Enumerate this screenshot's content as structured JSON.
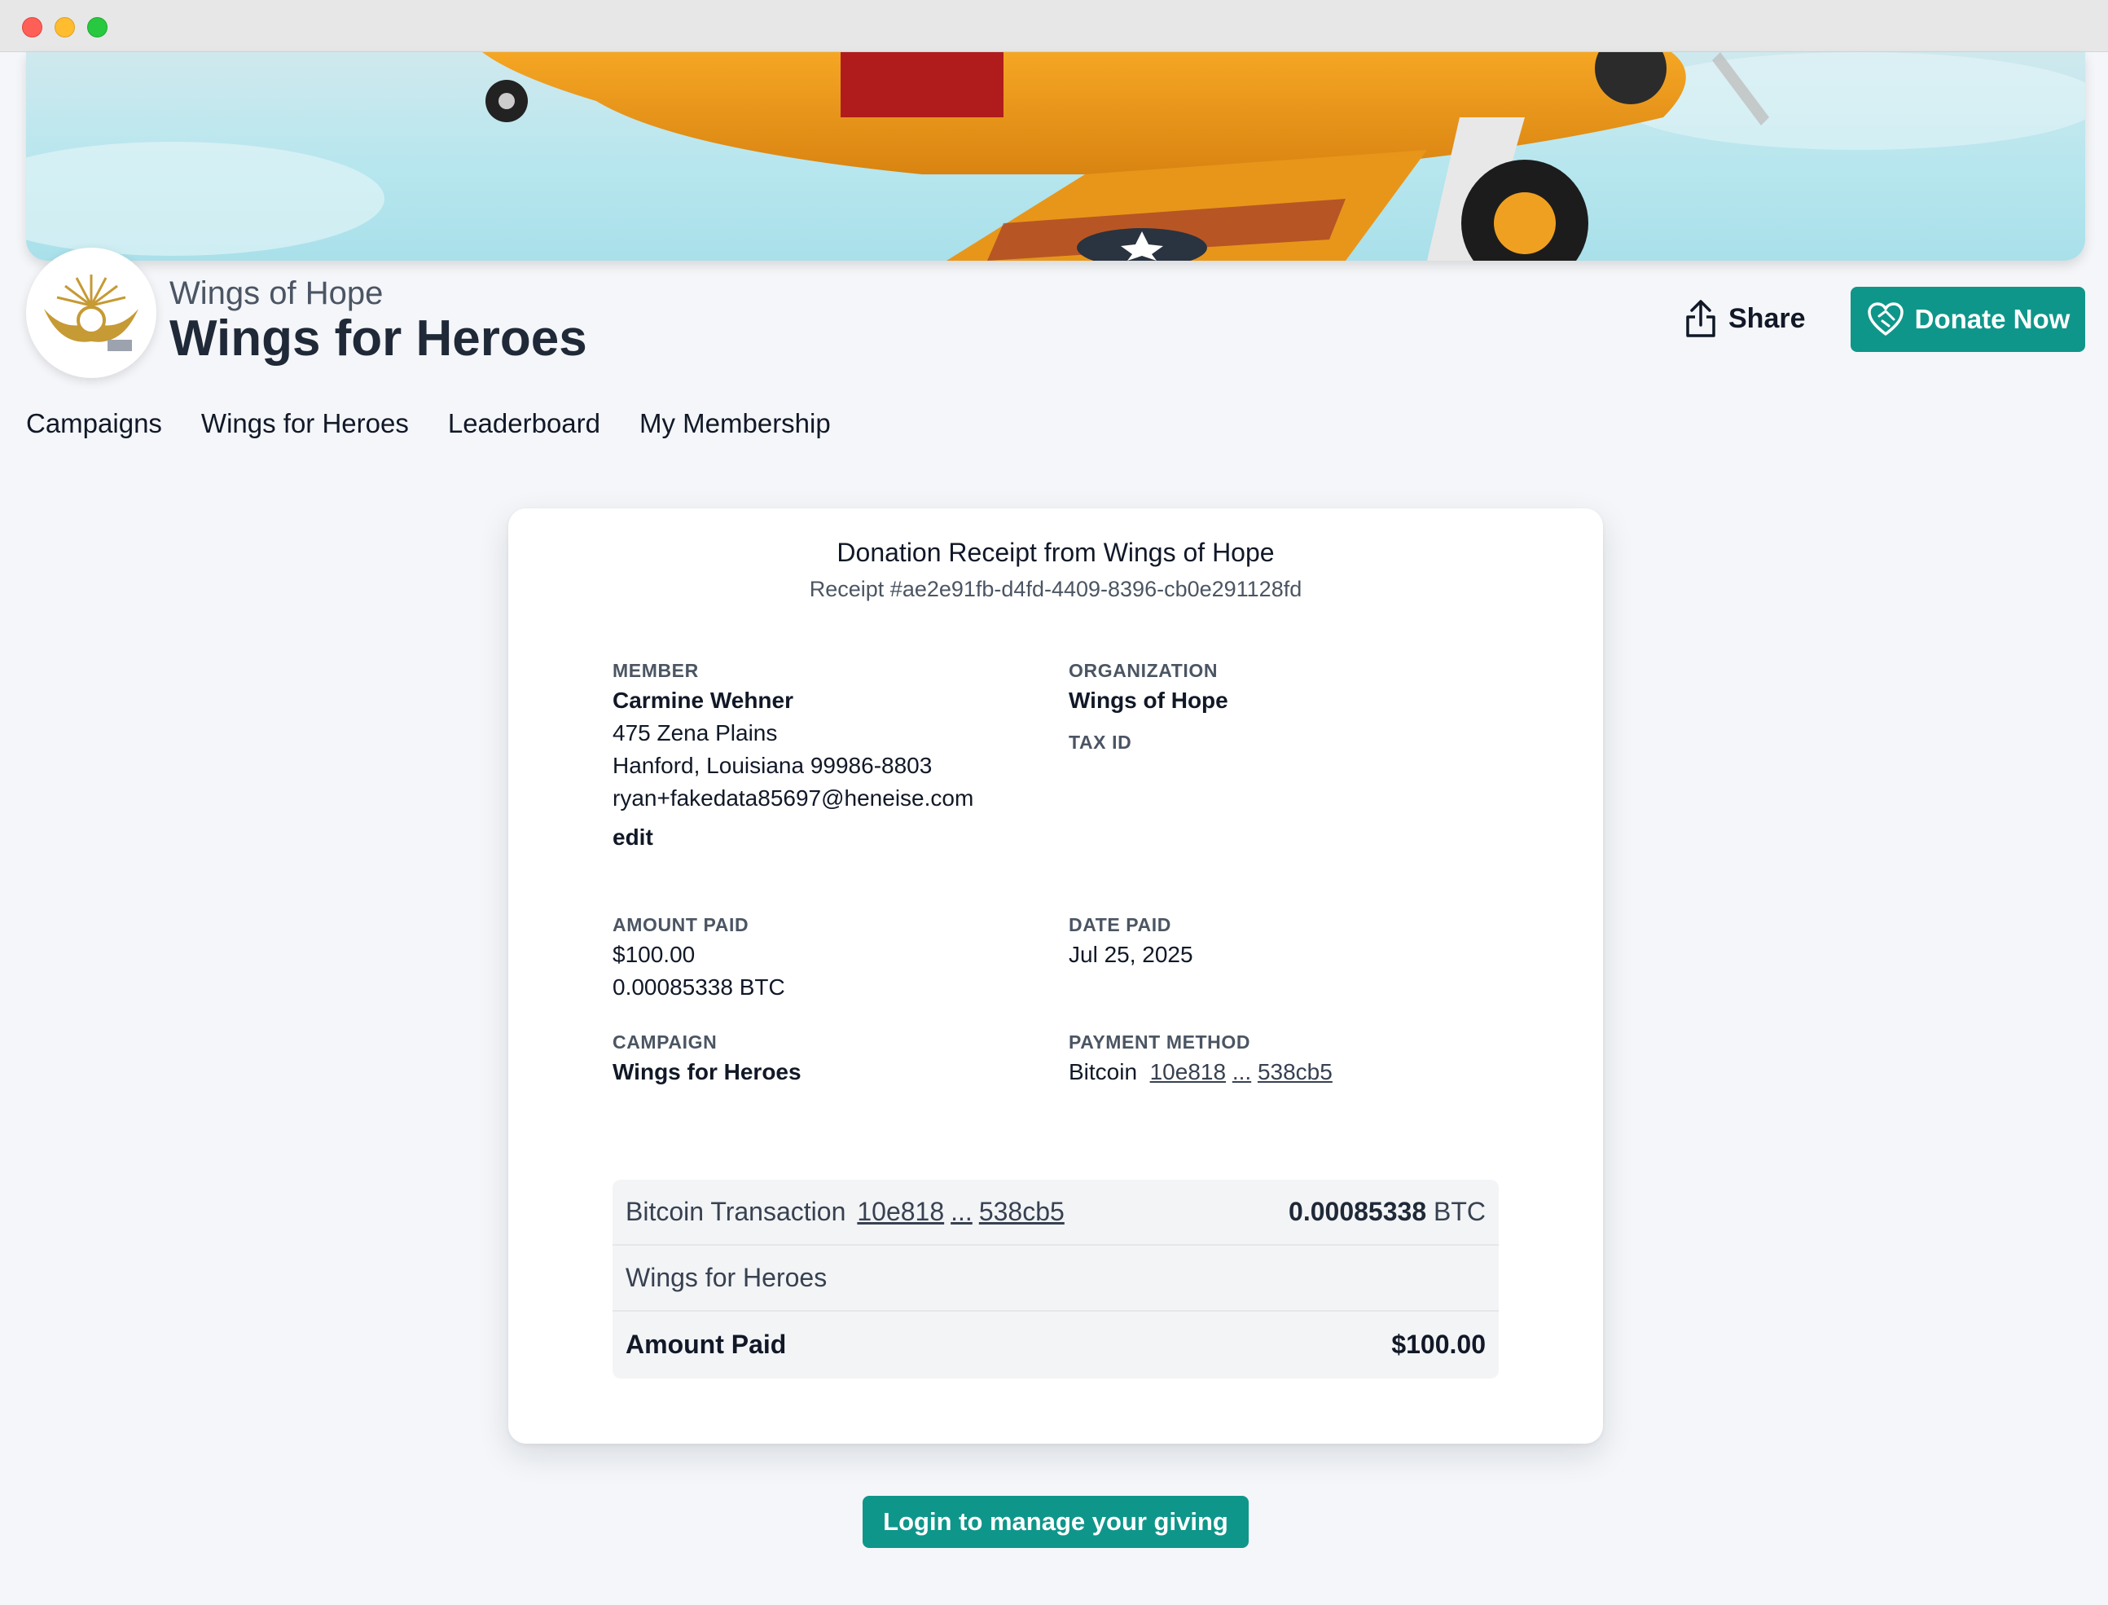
{
  "org": {
    "name": "Wings of Hope"
  },
  "campaign": {
    "title": "Wings for Heroes"
  },
  "header": {
    "share_label": "Share",
    "donate_label": "Donate Now"
  },
  "nav": {
    "items": [
      {
        "label": "Campaigns"
      },
      {
        "label": "Wings for Heroes"
      },
      {
        "label": "Leaderboard"
      },
      {
        "label": "My Membership"
      }
    ]
  },
  "receipt": {
    "title": "Donation Receipt from Wings of Hope",
    "id": "Receipt #ae2e91fb-d4fd-4409-8396-cb0e291128fd",
    "member": {
      "label": "MEMBER",
      "name": "Carmine Wehner",
      "address1": "475 Zena Plains",
      "address2": "Hanford, Louisiana 99986-8803",
      "email": "ryan+fakedata85697@heneise.com",
      "edit_label": "edit"
    },
    "organization": {
      "label": "ORGANIZATION",
      "name": "Wings of Hope",
      "tax_label": "TAX ID"
    },
    "amount": {
      "label": "AMOUNT PAID",
      "usd": "$100.00",
      "btc": "0.00085338 BTC"
    },
    "date": {
      "label": "DATE PAID",
      "value": "Jul 25, 2025"
    },
    "campaign": {
      "label": "CAMPAIGN",
      "value": "Wings for Heroes"
    },
    "payment": {
      "label": "PAYMENT METHOD",
      "method": "Bitcoin",
      "tx_start": "10e818",
      "ellipsis": "...",
      "tx_end": "538cb5"
    }
  },
  "transaction": {
    "label": "Bitcoin Transaction",
    "tx_start": "10e818",
    "ellipsis": "...",
    "tx_end": "538cb5",
    "btc_amount": "0.00085338",
    "btc_unit": "BTC",
    "campaign": "Wings for Heroes",
    "total_label": "Amount Paid",
    "total_value": "$100.00"
  },
  "footer": {
    "login_label": "Login to manage your giving"
  },
  "colors": {
    "accent": "#0f968a",
    "background": "#f4f6f9"
  },
  "icons": {
    "share": "share-upload-icon",
    "donate": "heart-handshake-icon",
    "logo": "winged-sun-logo"
  }
}
